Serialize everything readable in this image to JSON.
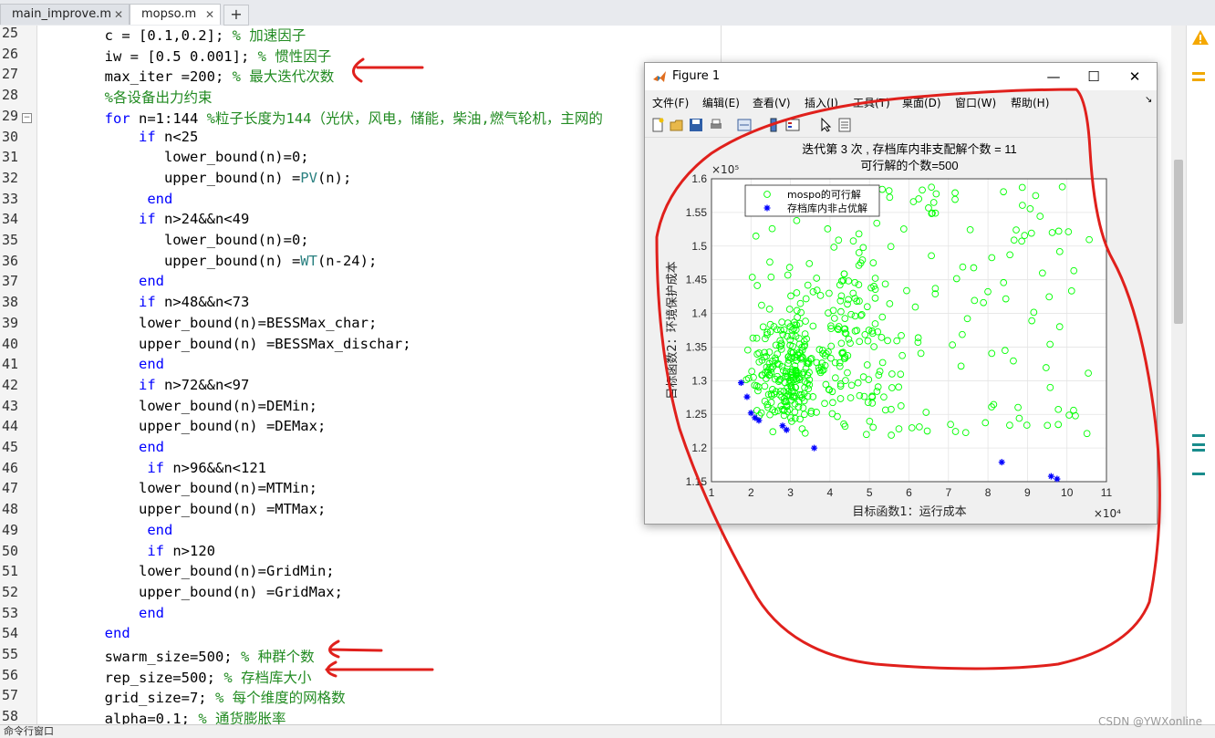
{
  "tabs": [
    {
      "label": "main_improve.m"
    },
    {
      "label": "mopso.m"
    }
  ],
  "tab_add": "+",
  "editor": {
    "lines": [
      {
        "n": "25",
        "segs": [
          {
            "t": "        c = [0.1,0.2]; ",
            "c": ""
          },
          {
            "t": "% 加速因子",
            "c": "cm"
          }
        ]
      },
      {
        "n": "26",
        "segs": [
          {
            "t": "        iw = [0.5 0.001]; ",
            "c": ""
          },
          {
            "t": "% 惯性因子",
            "c": "cm"
          }
        ]
      },
      {
        "n": "27",
        "segs": [
          {
            "t": "        max_iter =200; ",
            "c": ""
          },
          {
            "t": "% 最大迭代次数",
            "c": "cm"
          }
        ]
      },
      {
        "n": "28",
        "segs": [
          {
            "t": "        %各设备出力约束",
            "c": "cm"
          }
        ]
      },
      {
        "n": "29",
        "segs": [
          {
            "t": "        ",
            "c": ""
          },
          {
            "t": "for",
            "c": "kw"
          },
          {
            "t": " n=1:144 ",
            "c": ""
          },
          {
            "t": "%粒子长度为144（光伏，风电，储能，柴油,燃气轮机，主网的",
            "c": "cm"
          }
        ],
        "fold": true
      },
      {
        "n": "30",
        "segs": [
          {
            "t": "            ",
            "c": ""
          },
          {
            "t": "if",
            "c": "kw"
          },
          {
            "t": " n<25",
            "c": ""
          }
        ]
      },
      {
        "n": "31",
        "segs": [
          {
            "t": "               lower_bound(n)=0;",
            "c": ""
          }
        ]
      },
      {
        "n": "32",
        "segs": [
          {
            "t": "               upper_bound(n) =",
            "c": ""
          },
          {
            "t": "PV",
            "c": "fn"
          },
          {
            "t": "(n);",
            "c": ""
          }
        ]
      },
      {
        "n": "33",
        "segs": [
          {
            "t": "             ",
            "c": ""
          },
          {
            "t": "end",
            "c": "kw"
          }
        ]
      },
      {
        "n": "34",
        "segs": [
          {
            "t": "            ",
            "c": ""
          },
          {
            "t": "if",
            "c": "kw"
          },
          {
            "t": " n>24&&n<49",
            "c": ""
          }
        ]
      },
      {
        "n": "35",
        "segs": [
          {
            "t": "               lower_bound(n)=0;",
            "c": ""
          }
        ]
      },
      {
        "n": "36",
        "segs": [
          {
            "t": "               upper_bound(n) =",
            "c": ""
          },
          {
            "t": "WT",
            "c": "fn"
          },
          {
            "t": "(n-24);",
            "c": ""
          }
        ]
      },
      {
        "n": "37",
        "segs": [
          {
            "t": "            ",
            "c": ""
          },
          {
            "t": "end",
            "c": "kw"
          }
        ]
      },
      {
        "n": "38",
        "segs": [
          {
            "t": "            ",
            "c": ""
          },
          {
            "t": "if",
            "c": "kw"
          },
          {
            "t": " n>48&&n<73",
            "c": ""
          }
        ]
      },
      {
        "n": "39",
        "segs": [
          {
            "t": "            lower_bound(n)=BESSMax_char;",
            "c": ""
          }
        ]
      },
      {
        "n": "40",
        "segs": [
          {
            "t": "            upper_bound(n) =BESSMax_dischar;",
            "c": ""
          }
        ]
      },
      {
        "n": "41",
        "segs": [
          {
            "t": "            ",
            "c": ""
          },
          {
            "t": "end",
            "c": "kw"
          }
        ]
      },
      {
        "n": "42",
        "segs": [
          {
            "t": "            ",
            "c": ""
          },
          {
            "t": "if",
            "c": "kw"
          },
          {
            "t": " n>72&&n<97",
            "c": ""
          }
        ]
      },
      {
        "n": "43",
        "segs": [
          {
            "t": "            lower_bound(n)=DEMin;",
            "c": ""
          }
        ]
      },
      {
        "n": "44",
        "segs": [
          {
            "t": "            upper_bound(n) =DEMax;",
            "c": ""
          }
        ]
      },
      {
        "n": "45",
        "segs": [
          {
            "t": "            ",
            "c": ""
          },
          {
            "t": "end",
            "c": "kw"
          }
        ]
      },
      {
        "n": "46",
        "segs": [
          {
            "t": "             ",
            "c": ""
          },
          {
            "t": "if",
            "c": "kw"
          },
          {
            "t": " n>96&&n<121",
            "c": ""
          }
        ]
      },
      {
        "n": "47",
        "segs": [
          {
            "t": "            lower_bound(n)=MTMin;",
            "c": ""
          }
        ]
      },
      {
        "n": "48",
        "segs": [
          {
            "t": "            upper_bound(n) =MTMax;",
            "c": ""
          }
        ]
      },
      {
        "n": "49",
        "segs": [
          {
            "t": "             ",
            "c": ""
          },
          {
            "t": "end",
            "c": "kw"
          }
        ]
      },
      {
        "n": "50",
        "segs": [
          {
            "t": "             ",
            "c": ""
          },
          {
            "t": "if",
            "c": "kw"
          },
          {
            "t": " n>120",
            "c": ""
          }
        ]
      },
      {
        "n": "51",
        "segs": [
          {
            "t": "            lower_bound(n)=GridMin;",
            "c": ""
          }
        ]
      },
      {
        "n": "52",
        "segs": [
          {
            "t": "            upper_bound(n) =GridMax;",
            "c": ""
          }
        ]
      },
      {
        "n": "53",
        "segs": [
          {
            "t": "            ",
            "c": ""
          },
          {
            "t": "end",
            "c": "kw"
          }
        ]
      },
      {
        "n": "54",
        "segs": [
          {
            "t": "        ",
            "c": ""
          },
          {
            "t": "end",
            "c": "kw"
          }
        ]
      },
      {
        "n": "55",
        "segs": [
          {
            "t": "        swarm_size=500; ",
            "c": ""
          },
          {
            "t": "% 种群个数",
            "c": "cm"
          }
        ]
      },
      {
        "n": "56",
        "segs": [
          {
            "t": "        rep_size=500; ",
            "c": ""
          },
          {
            "t": "% 存档库大小",
            "c": "cm"
          }
        ]
      },
      {
        "n": "57",
        "segs": [
          {
            "t": "        grid_size=7; ",
            "c": ""
          },
          {
            "t": "% 每个维度的网格数",
            "c": "cm"
          }
        ]
      },
      {
        "n": "58",
        "segs": [
          {
            "t": "        alpha=0.1; ",
            "c": ""
          },
          {
            "t": "% 通货膨胀率",
            "c": "cm"
          }
        ]
      }
    ]
  },
  "figure": {
    "title": "Figure 1",
    "menu": [
      "文件(F)",
      "编辑(E)",
      "查看(V)",
      "插入(I)",
      "工具(T)",
      "桌面(D)",
      "窗口(W)",
      "帮助(H)"
    ],
    "colors": {
      "feasible": "#00ff00",
      "nondominated": "#0000ff",
      "annotation": "#e0201c"
    }
  },
  "chart_data": {
    "type": "scatter",
    "title": [
      "迭代第 3 次 , 存档库内非支配解个数 = 11",
      "可行解的个数=500"
    ],
    "xlabel": "目标函数1：运行成本",
    "ylabel": "目标函数2：环境保护成本",
    "x_exponent": "×10⁴",
    "y_exponent": "×10⁵",
    "xlim": [
      1,
      11
    ],
    "ylim": [
      1.15,
      1.6
    ],
    "xticks": [
      "1",
      "2",
      "3",
      "4",
      "5",
      "6",
      "7",
      "8",
      "9",
      "10",
      "11"
    ],
    "yticks": [
      "1.15",
      "1.2",
      "1.25",
      "1.3",
      "1.35",
      "1.4",
      "1.45",
      "1.5",
      "1.55",
      "1.6"
    ],
    "grid": true,
    "legend_position": "top-left",
    "series": [
      {
        "name": "mospo的可行解",
        "marker": "circle",
        "color": "#00ff00",
        "count": 500
      },
      {
        "name": "存档库内非占优解",
        "marker": "asterisk",
        "color": "#0000ff",
        "x": [
          1.75,
          1.9,
          2.0,
          2.1,
          2.2,
          2.8,
          2.9,
          3.6,
          8.35,
          9.6,
          9.75
        ],
        "y": [
          1.297,
          1.276,
          1.252,
          1.245,
          1.241,
          1.233,
          1.227,
          1.2,
          1.179,
          1.158,
          1.154
        ]
      }
    ]
  },
  "status": {
    "left": "命令行窗口",
    "watermark": "CSDN @YWXonline"
  }
}
